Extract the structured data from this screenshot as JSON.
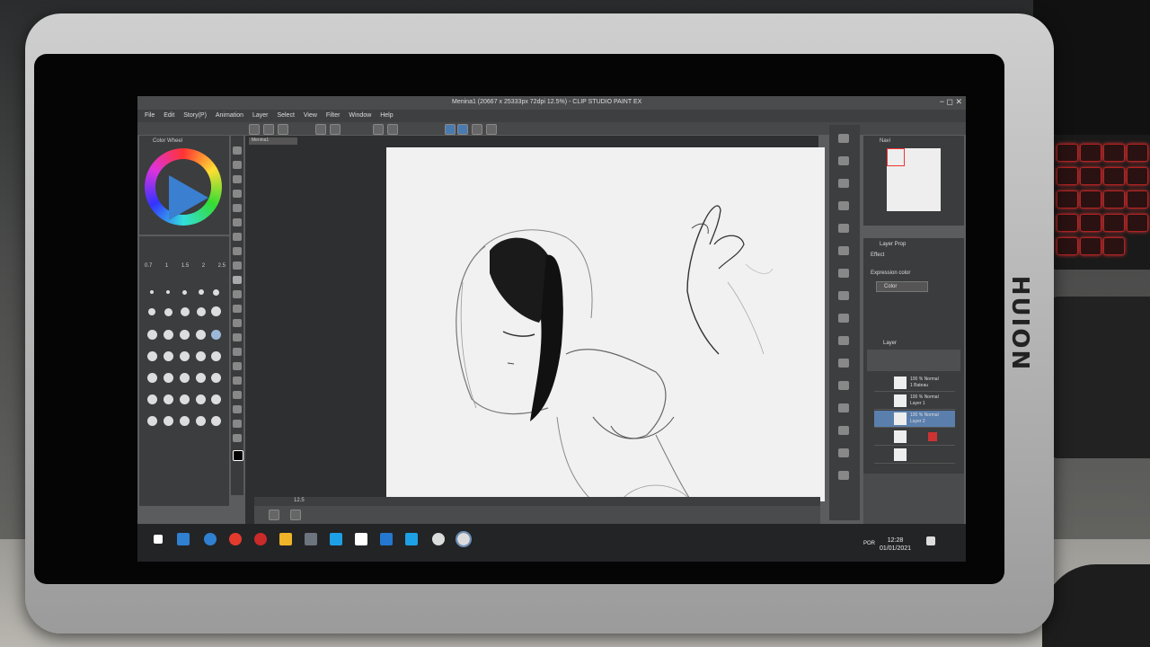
{
  "window": {
    "title": "Menina1 (20667 x 25333px 72dpi 12.5%) - CLIP STUDIO PAINT EX",
    "controls": "− ◻ ✕"
  },
  "menu": [
    "File",
    "Edit",
    "Story(P)",
    "Animation",
    "Layer",
    "Select",
    "View",
    "Filter",
    "Window",
    "Help"
  ],
  "panels": {
    "color": {
      "label": "Color Wheel"
    },
    "navigator": {
      "label": "Navi"
    },
    "layer_property": {
      "label": "Layer Prop",
      "effect_label": "Effect",
      "expression_label": "Expression color",
      "expression_value": "Color"
    },
    "layer": {
      "label": "Layer"
    }
  },
  "brush_sizes": [
    "0.7",
    "1",
    "1.5",
    "2",
    "2.5"
  ],
  "canvas": {
    "tab_label": "Menina1",
    "zoom": "12.5"
  },
  "layers": [
    {
      "line1": "100 % Normal",
      "line2": "1 Bateau",
      "selected": false
    },
    {
      "line1": "100 % Normal",
      "line2": "Layer 1",
      "selected": false
    },
    {
      "line1": "100 % Normal",
      "line2": "Layer 2",
      "selected": true
    },
    {
      "line1": "",
      "line2": "",
      "selected": false
    },
    {
      "line1": "",
      "line2": "",
      "selected": false
    }
  ],
  "taskbar": {
    "lang": "POR",
    "time": "12:28",
    "date": "01/01/2021",
    "icon_colors": [
      "#ffffff",
      "#2f80d0",
      "#e23b2e",
      "#c92a2a",
      "#f0b429",
      "#6c757d",
      "#1ea0e6",
      "#ffffff",
      "#2478d0",
      "#1ea0e6",
      "#dcdcdc",
      "#dcdcdc"
    ]
  },
  "device": {
    "brand": "HUION"
  }
}
